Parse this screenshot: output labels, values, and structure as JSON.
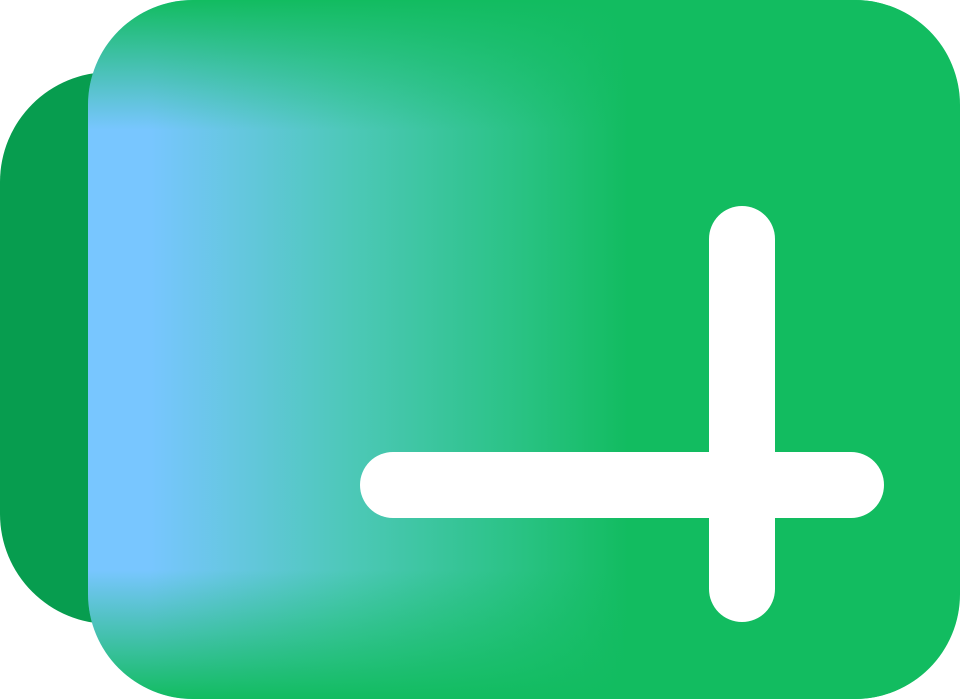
{
  "icon": {
    "name": "add-folder-icon",
    "colors": {
      "back_tab": "#079D4F",
      "front_panel": "#12BC60",
      "gradient_start": "#78C6FF",
      "plus": "#FFFFFF"
    }
  }
}
